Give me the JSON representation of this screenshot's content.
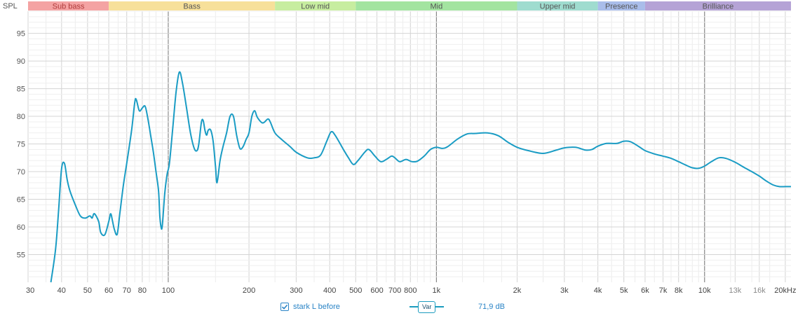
{
  "chart_data": {
    "type": "line",
    "ylabel": "SPL",
    "xlabel": "",
    "x_scale": "log",
    "xlim": [
      30,
      21000
    ],
    "ylim": [
      50,
      99
    ],
    "y_ticks": [
      55,
      60,
      65,
      70,
      75,
      80,
      85,
      90,
      95
    ],
    "x_ticks": [
      {
        "v": 30,
        "label": "30"
      },
      {
        "v": 40,
        "label": "40"
      },
      {
        "v": 50,
        "label": "50"
      },
      {
        "v": 60,
        "label": "60"
      },
      {
        "v": 70,
        "label": "70"
      },
      {
        "v": 80,
        "label": "80"
      },
      {
        "v": 100,
        "label": "100"
      },
      {
        "v": 200,
        "label": "200"
      },
      {
        "v": 300,
        "label": "300"
      },
      {
        "v": 400,
        "label": "400"
      },
      {
        "v": 500,
        "label": "500"
      },
      {
        "v": 600,
        "label": "600"
      },
      {
        "v": 700,
        "label": "700"
      },
      {
        "v": 800,
        "label": "800"
      },
      {
        "v": 1000,
        "label": "1k"
      },
      {
        "v": 2000,
        "label": "2k"
      },
      {
        "v": 3000,
        "label": "3k"
      },
      {
        "v": 4000,
        "label": "4k"
      },
      {
        "v": 5000,
        "label": "5k"
      },
      {
        "v": 6000,
        "label": "6k"
      },
      {
        "v": 7000,
        "label": "7k"
      },
      {
        "v": 8000,
        "label": "8k"
      },
      {
        "v": 10000,
        "label": "10k"
      },
      {
        "v": 13000,
        "label": "13k"
      },
      {
        "v": 16000,
        "label": "16k"
      },
      {
        "v": 20000,
        "label": "20kHz"
      }
    ],
    "bands": [
      {
        "label": "Sub bass",
        "from": 30,
        "to": 60,
        "color": "#f4a3a3",
        "text_color": "#b03a3a"
      },
      {
        "label": "Bass",
        "from": 60,
        "to": 250,
        "color": "#f7e09a",
        "text_color": "#555555"
      },
      {
        "label": "Low mid",
        "from": 250,
        "to": 500,
        "color": "#c7eda0",
        "text_color": "#555555"
      },
      {
        "label": "Mid",
        "from": 500,
        "to": 2000,
        "color": "#a3e4a0",
        "text_color": "#555555"
      },
      {
        "label": "Upper mid",
        "from": 2000,
        "to": 4000,
        "color": "#9fdccf",
        "text_color": "#555555"
      },
      {
        "label": "Presence",
        "from": 4000,
        "to": 6000,
        "color": "#a9bdea",
        "text_color": "#555555"
      },
      {
        "label": "Brilliance",
        "from": 6000,
        "to": 21000,
        "color": "#b5a3d6",
        "text_color": "#555555"
      }
    ],
    "series": [
      {
        "name": "stark L before",
        "color": "#1a9cc4",
        "points": [
          [
            36.5,
            50
          ],
          [
            38,
            56
          ],
          [
            39,
            63
          ],
          [
            40,
            70.5
          ],
          [
            41,
            71.5
          ],
          [
            42,
            68.5
          ],
          [
            43,
            66.5
          ],
          [
            45,
            64
          ],
          [
            47,
            62
          ],
          [
            49,
            61.6
          ],
          [
            51,
            62
          ],
          [
            52,
            61.6
          ],
          [
            53,
            62.4
          ],
          [
            55,
            61
          ],
          [
            56,
            59
          ],
          [
            58,
            58.6
          ],
          [
            60,
            61
          ],
          [
            61,
            62.4
          ],
          [
            62,
            61
          ],
          [
            63,
            59.5
          ],
          [
            64.5,
            58.7
          ],
          [
            66,
            62.5
          ],
          [
            68,
            67.5
          ],
          [
            70,
            71.5
          ],
          [
            73,
            77.5
          ],
          [
            75,
            82.5
          ],
          [
            76,
            83
          ],
          [
            78,
            81
          ],
          [
            80,
            81.5
          ],
          [
            82,
            81.8
          ],
          [
            84,
            79.5
          ],
          [
            86,
            76.5
          ],
          [
            88,
            73.5
          ],
          [
            90,
            70
          ],
          [
            92,
            66.5
          ],
          [
            93,
            62
          ],
          [
            94,
            60
          ],
          [
            95,
            60.2
          ],
          [
            97,
            66
          ],
          [
            99,
            69.5
          ],
          [
            101,
            71.5
          ],
          [
            104,
            78
          ],
          [
            107,
            84.5
          ],
          [
            110,
            88
          ],
          [
            113,
            86
          ],
          [
            117,
            81.5
          ],
          [
            121,
            77
          ],
          [
            125,
            74.2
          ],
          [
            128,
            73.8
          ],
          [
            130,
            75
          ],
          [
            133,
            79
          ],
          [
            135,
            79.2
          ],
          [
            137,
            77.5
          ],
          [
            139,
            76.6
          ],
          [
            141,
            77.5
          ],
          [
            144,
            77.5
          ],
          [
            147,
            75.5
          ],
          [
            150,
            71
          ],
          [
            152,
            68
          ],
          [
            156,
            72
          ],
          [
            160,
            74.5
          ],
          [
            165,
            77
          ],
          [
            170,
            80
          ],
          [
            175,
            80
          ],
          [
            180,
            76.5
          ],
          [
            185,
            74.2
          ],
          [
            190,
            74.5
          ],
          [
            195,
            75.8
          ],
          [
            200,
            77
          ],
          [
            205,
            80
          ],
          [
            210,
            81
          ],
          [
            215,
            79.8
          ],
          [
            225,
            78.8
          ],
          [
            235,
            79.5
          ],
          [
            240,
            79
          ],
          [
            250,
            77
          ],
          [
            265,
            75.8
          ],
          [
            285,
            74.5
          ],
          [
            300,
            73.5
          ],
          [
            330,
            72.5
          ],
          [
            350,
            72.5
          ],
          [
            370,
            73
          ],
          [
            390,
            75.5
          ],
          [
            405,
            77.2
          ],
          [
            420,
            76.5
          ],
          [
            450,
            74
          ],
          [
            470,
            72.5
          ],
          [
            490,
            71.3
          ],
          [
            510,
            72
          ],
          [
            540,
            73.5
          ],
          [
            560,
            74
          ],
          [
            590,
            72.8
          ],
          [
            620,
            71.8
          ],
          [
            650,
            72.2
          ],
          [
            680,
            72.8
          ],
          [
            700,
            72.5
          ],
          [
            730,
            71.8
          ],
          [
            770,
            72.2
          ],
          [
            810,
            71.8
          ],
          [
            850,
            71.9
          ],
          [
            900,
            72.8
          ],
          [
            950,
            74
          ],
          [
            1000,
            74.4
          ],
          [
            1050,
            74.2
          ],
          [
            1100,
            74.5
          ],
          [
            1200,
            75.9
          ],
          [
            1300,
            76.8
          ],
          [
            1400,
            76.9
          ],
          [
            1550,
            77
          ],
          [
            1700,
            76.5
          ],
          [
            1850,
            75.3
          ],
          [
            2000,
            74.4
          ],
          [
            2200,
            73.8
          ],
          [
            2500,
            73.3
          ],
          [
            2800,
            73.9
          ],
          [
            3000,
            74.3
          ],
          [
            3300,
            74.4
          ],
          [
            3600,
            73.9
          ],
          [
            3800,
            74
          ],
          [
            4000,
            74.6
          ],
          [
            4300,
            75.1
          ],
          [
            4700,
            75.1
          ],
          [
            5000,
            75.5
          ],
          [
            5300,
            75.4
          ],
          [
            5700,
            74.5
          ],
          [
            6000,
            73.8
          ],
          [
            6500,
            73.2
          ],
          [
            7000,
            72.8
          ],
          [
            7500,
            72.4
          ],
          [
            8000,
            71.8
          ],
          [
            8500,
            71.2
          ],
          [
            9000,
            70.7
          ],
          [
            9500,
            70.6
          ],
          [
            10000,
            71
          ],
          [
            10600,
            71.8
          ],
          [
            11300,
            72.5
          ],
          [
            12000,
            72.4
          ],
          [
            13000,
            71.7
          ],
          [
            14000,
            70.8
          ],
          [
            15000,
            70
          ],
          [
            16000,
            69.2
          ],
          [
            17000,
            68.3
          ],
          [
            18000,
            67.6
          ],
          [
            19000,
            67.3
          ],
          [
            20000,
            67.3
          ],
          [
            21000,
            67.3
          ]
        ]
      }
    ]
  },
  "legend": {
    "series_label": "stark L before",
    "var_button_label": "Var",
    "value_readout": "71,9 dB",
    "checked": true
  }
}
